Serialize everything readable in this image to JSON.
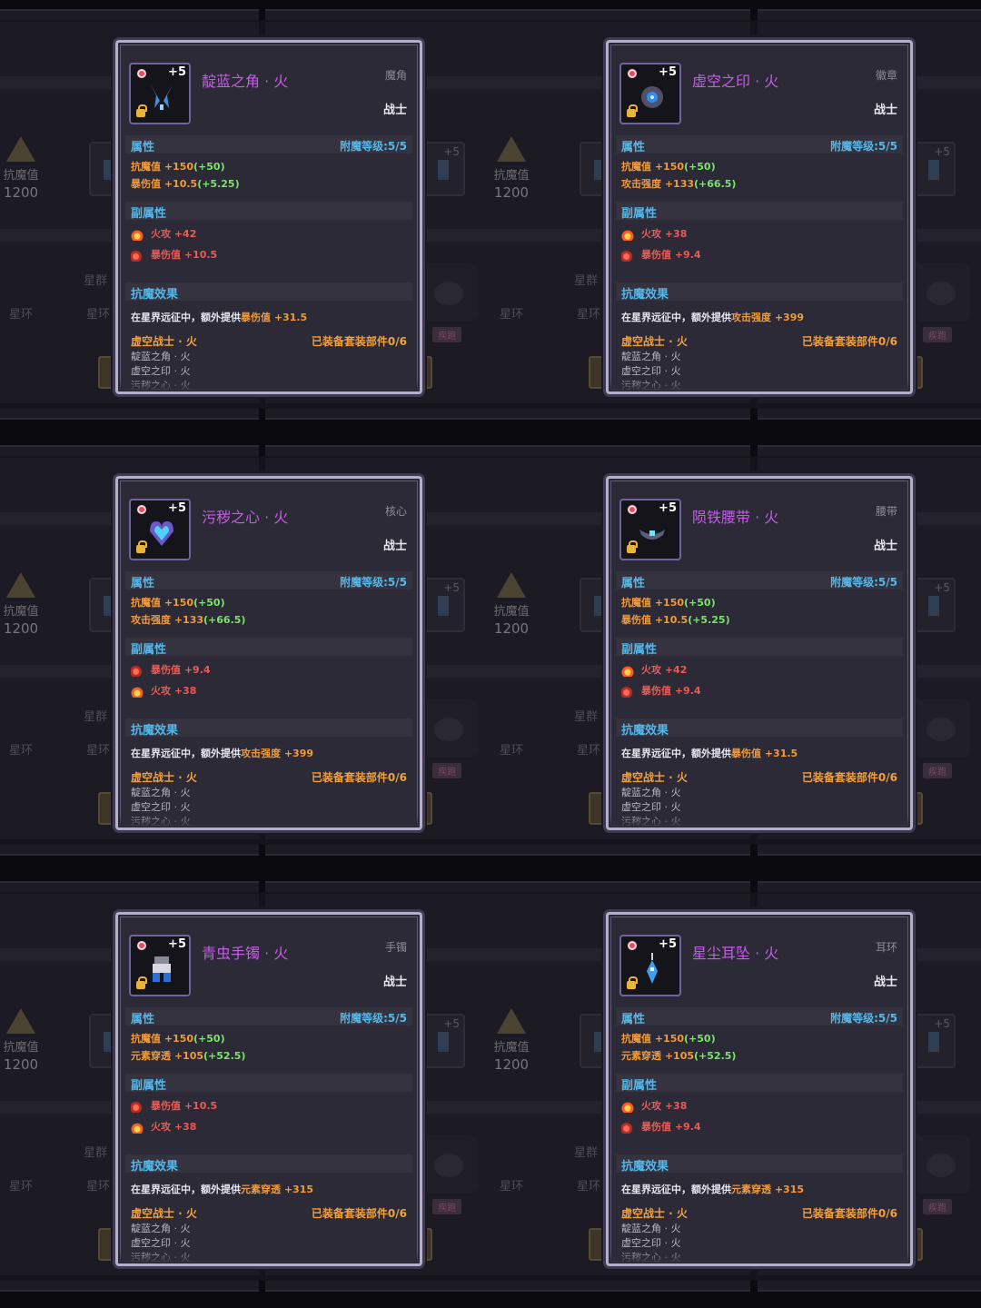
{
  "background": {
    "stat_label": "抗魔值",
    "stat_value": "1200",
    "constellation_label": "星群",
    "ring_label": "星环",
    "plus_tag": "+5",
    "sprint_chip": "疾跑"
  },
  "cards": [
    {
      "title": "靛蓝之角 · 火",
      "slot": "魔角",
      "class": "战士",
      "plus": "+5",
      "attr_label": "属性",
      "enchant": "附魔等级:5/5",
      "main": [
        {
          "name": "抗魔值 +150",
          "bonus": "(+50)"
        },
        {
          "name": "暴伤值 +10.5",
          "bonus": "(+5.25)"
        }
      ],
      "sub_label": "副属性",
      "subs": [
        {
          "icon": "fire-icon",
          "text": "火攻 +42"
        },
        {
          "icon": "crit-icon",
          "text": "暴伤值 +10.5"
        }
      ],
      "effect_label": "抗魔效果",
      "effect_pre": "在星界远征中，额外提供",
      "effect_hl": "暴伤值",
      "effect_post": " +31.5",
      "set_name": "虚空战士 · 火",
      "set_count": "已装备套装部件0/6",
      "set_items": [
        "靛蓝之角 · 火",
        "虚空之印 · 火",
        "污秽之心 · 火"
      ]
    },
    {
      "title": "虚空之印 · 火",
      "slot": "徽章",
      "class": "战士",
      "plus": "+5",
      "attr_label": "属性",
      "enchant": "附魔等级:5/5",
      "main": [
        {
          "name": "抗魔值 +150",
          "bonus": "(+50)"
        },
        {
          "name": "攻击强度 +133",
          "bonus": "(+66.5)"
        }
      ],
      "sub_label": "副属性",
      "subs": [
        {
          "icon": "fire-icon",
          "text": "火攻 +38"
        },
        {
          "icon": "crit-icon",
          "text": "暴伤值 +9.4"
        }
      ],
      "effect_label": "抗魔效果",
      "effect_pre": "在星界远征中，额外提供",
      "effect_hl": "攻击强度",
      "effect_post": " +399",
      "set_name": "虚空战士 · 火",
      "set_count": "已装备套装部件0/6",
      "set_items": [
        "靛蓝之角 · 火",
        "虚空之印 · 火",
        "污秽之心 · 火"
      ]
    },
    {
      "title": "污秽之心 · 火",
      "slot": "核心",
      "class": "战士",
      "plus": "+5",
      "attr_label": "属性",
      "enchant": "附魔等级:5/5",
      "main": [
        {
          "name": "抗魔值 +150",
          "bonus": "(+50)"
        },
        {
          "name": "攻击强度 +133",
          "bonus": "(+66.5)"
        }
      ],
      "sub_label": "副属性",
      "subs": [
        {
          "icon": "crit-icon",
          "text": "暴伤值 +9.4"
        },
        {
          "icon": "fire-icon",
          "text": "火攻 +38"
        }
      ],
      "effect_label": "抗魔效果",
      "effect_pre": "在星界远征中，额外提供",
      "effect_hl": "攻击强度",
      "effect_post": " +399",
      "set_name": "虚空战士 · 火",
      "set_count": "已装备套装部件0/6",
      "set_items": [
        "靛蓝之角 · 火",
        "虚空之印 · 火",
        "污秽之心 · 火"
      ]
    },
    {
      "title": "陨铁腰带 · 火",
      "slot": "腰带",
      "class": "战士",
      "plus": "+5",
      "attr_label": "属性",
      "enchant": "附魔等级:5/5",
      "main": [
        {
          "name": "抗魔值 +150",
          "bonus": "(+50)"
        },
        {
          "name": "暴伤值 +10.5",
          "bonus": "(+5.25)"
        }
      ],
      "sub_label": "副属性",
      "subs": [
        {
          "icon": "fire-icon",
          "text": "火攻 +42"
        },
        {
          "icon": "crit-icon",
          "text": "暴伤值 +9.4"
        }
      ],
      "effect_label": "抗魔效果",
      "effect_pre": "在星界远征中，额外提供",
      "effect_hl": "暴伤值",
      "effect_post": " +31.5",
      "set_name": "虚空战士 · 火",
      "set_count": "已装备套装部件0/6",
      "set_items": [
        "靛蓝之角 · 火",
        "虚空之印 · 火",
        "污秽之心 · 火"
      ]
    },
    {
      "title": "青虫手镯 · 火",
      "slot": "手镯",
      "class": "战士",
      "plus": "+5",
      "attr_label": "属性",
      "enchant": "附魔等级:5/5",
      "main": [
        {
          "name": "抗魔值 +150",
          "bonus": "(+50)"
        },
        {
          "name": "元素穿透 +105",
          "bonus": "(+52.5)"
        }
      ],
      "sub_label": "副属性",
      "subs": [
        {
          "icon": "crit-icon",
          "text": "暴伤值 +10.5"
        },
        {
          "icon": "fire-icon",
          "text": "火攻 +38"
        }
      ],
      "effect_label": "抗魔效果",
      "effect_pre": "在星界远征中，额外提供",
      "effect_hl": "元素穿透",
      "effect_post": " +315",
      "set_name": "虚空战士 · 火",
      "set_count": "已装备套装部件0/6",
      "set_items": [
        "靛蓝之角 · 火",
        "虚空之印 · 火",
        "污秽之心 · 火"
      ]
    },
    {
      "title": "星尘耳坠 · 火",
      "slot": "耳环",
      "class": "战士",
      "plus": "+5",
      "attr_label": "属性",
      "enchant": "附魔等级:5/5",
      "main": [
        {
          "name": "抗魔值 +150",
          "bonus": "(+50)"
        },
        {
          "name": "元素穿透 +105",
          "bonus": "(+52.5)"
        }
      ],
      "sub_label": "副属性",
      "subs": [
        {
          "icon": "fire-icon",
          "text": "火攻 +38"
        },
        {
          "icon": "crit-icon",
          "text": "暴伤值 +9.4"
        }
      ],
      "effect_label": "抗魔效果",
      "effect_pre": "在星界远征中，额外提供",
      "effect_hl": "元素穿透",
      "effect_post": " +315",
      "set_name": "虚空战士 · 火",
      "set_count": "已装备套装部件0/6",
      "set_items": [
        "靛蓝之角 · 火",
        "虚空之印 · 火",
        "污秽之心 · 火"
      ]
    }
  ],
  "colors": {
    "title": "#c85bea",
    "section": "#55b7e8",
    "main_stat": "#f29a3a",
    "bonus": "#7be36a",
    "sub_stat": "#ea5a56",
    "set": "#f0a040"
  }
}
